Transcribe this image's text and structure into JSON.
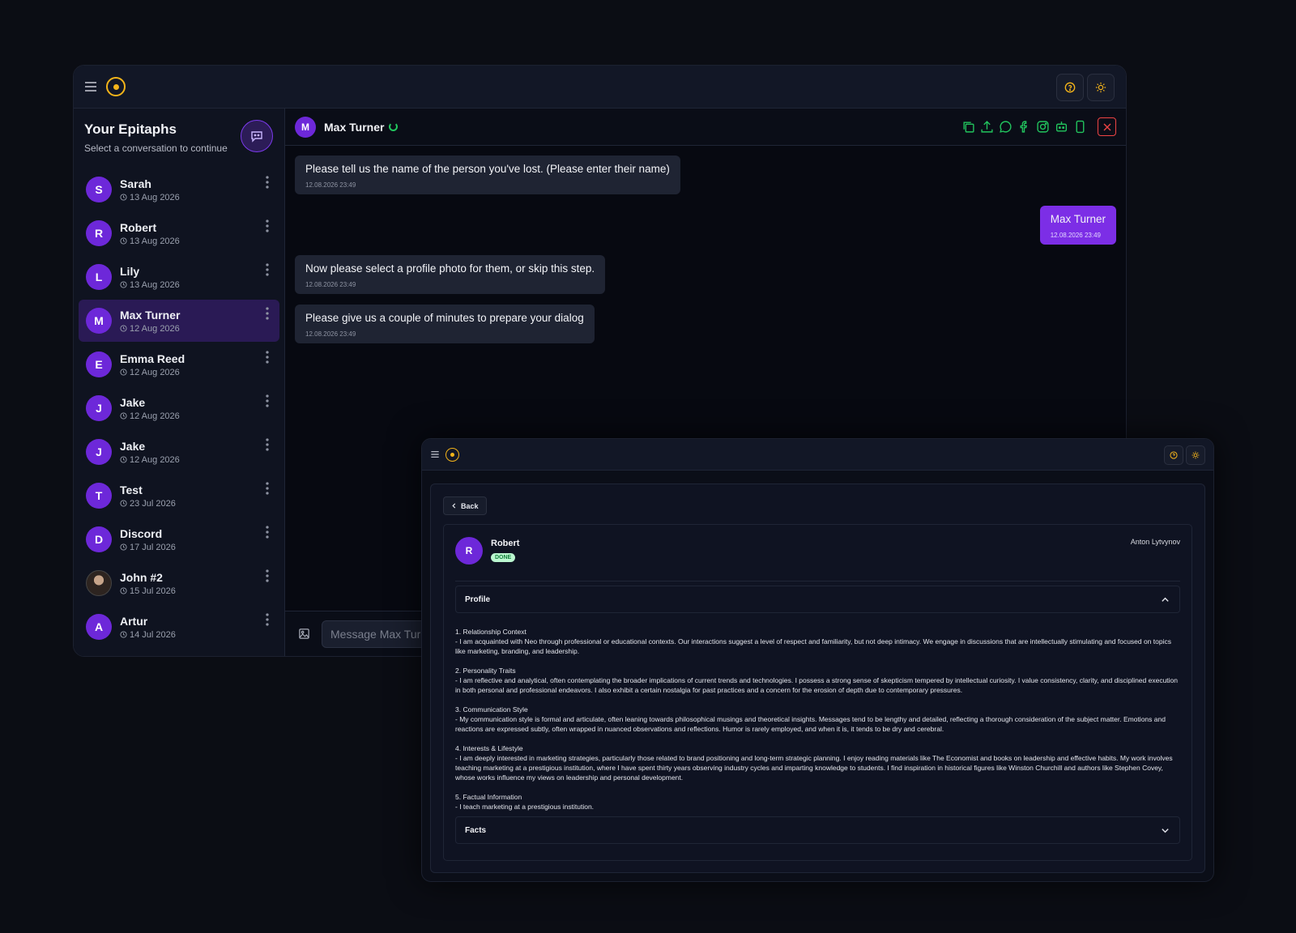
{
  "main": {
    "sidebar": {
      "title": "Your Epitaphs",
      "subtitle": "Select a conversation to continue",
      "conversations": [
        {
          "initial": "S",
          "name": "Sarah",
          "date": "13 Aug 2026"
        },
        {
          "initial": "R",
          "name": "Robert",
          "date": "13 Aug 2026"
        },
        {
          "initial": "L",
          "name": "Lily",
          "date": "13 Aug 2026"
        },
        {
          "initial": "M",
          "name": "Max Turner",
          "date": "12 Aug 2026"
        },
        {
          "initial": "E",
          "name": "Emma Reed",
          "date": "12 Aug 2026"
        },
        {
          "initial": "J",
          "name": "Jake",
          "date": "12 Aug 2026"
        },
        {
          "initial": "J",
          "name": "Jake",
          "date": "12 Aug 2026"
        },
        {
          "initial": "T",
          "name": "Test",
          "date": "23 Jul 2026"
        },
        {
          "initial": "D",
          "name": "Discord",
          "date": "17 Jul 2026"
        },
        {
          "initial": "",
          "name": "John #2",
          "date": "15 Jul 2026"
        },
        {
          "initial": "A",
          "name": "Artur",
          "date": "14 Jul 2026"
        }
      ]
    },
    "chat": {
      "contact_initial": "M",
      "contact_name": "Max Turner",
      "messages": [
        {
          "from": "bot",
          "text": "Please tell us the name of the person you've lost. (Please enter their name)",
          "time": "12.08.2026 23:49"
        },
        {
          "from": "user",
          "text": "Max Turner",
          "time": "12.08.2026 23:49"
        },
        {
          "from": "bot",
          "text": "Now please select a profile photo for them, or skip this step.",
          "time": "12.08.2026 23:49"
        },
        {
          "from": "bot",
          "text": "Please give us a couple of minutes to prepare your dialog",
          "time": "12.08.2026 23:49"
        }
      ],
      "composer_placeholder": "Message Max Turner"
    }
  },
  "detail": {
    "back_label": "Back",
    "initial": "R",
    "name": "Robert",
    "status": "DONE",
    "author": "Anton Lytvynov",
    "profile_label": "Profile",
    "facts_label": "Facts",
    "profile_sections": [
      {
        "heading": "1. Relationship Context",
        "body": "- I am acquainted with Neo through professional or educational contexts. Our interactions suggest a level of respect and familiarity, but not deep intimacy. We engage in discussions that are intellectually stimulating and focused on topics like marketing, branding, and leadership."
      },
      {
        "heading": "2. Personality Traits",
        "body": "- I am reflective and analytical, often contemplating the broader implications of current trends and technologies. I possess a strong sense of skepticism tempered by intellectual curiosity. I value consistency, clarity, and disciplined execution in both personal and professional endeavors. I also exhibit a certain nostalgia for past practices and a concern for the erosion of depth due to contemporary pressures."
      },
      {
        "heading": "3. Communication Style",
        "body": "- My communication style is formal and articulate, often leaning towards philosophical musings and theoretical insights. Messages tend to be lengthy and detailed, reflecting a thorough consideration of the subject matter. Emotions and reactions are expressed subtly, often wrapped in nuanced observations and reflections. Humor is rarely employed, and when it is, it tends to be dry and cerebral."
      },
      {
        "heading": "4. Interests & Lifestyle",
        "body": "- I am deeply interested in marketing strategies, particularly those related to brand positioning and long-term strategic planning. I enjoy reading materials like The Economist and books on leadership and effective habits. My work involves teaching marketing at a prestigious institution, where I have spent thirty years observing industry cycles and imparting knowledge to students. I find inspiration in historical figures like Winston Churchill and authors like Stephen Covey, whose works influence my views on leadership and personal development."
      },
      {
        "heading": "5. Factual Information",
        "body": "- I teach marketing at a prestigious institution."
      }
    ]
  },
  "colors": {
    "accent": "#7c3aed",
    "logo": "#f4b41a",
    "action_icons": "#22c55e",
    "close": "#ef4444"
  },
  "icons": {
    "header_actions": [
      "copy-icon",
      "upload-icon",
      "chat-bubble-icon",
      "facebook-icon",
      "instagram-icon",
      "bot-icon",
      "phone-icon"
    ]
  }
}
